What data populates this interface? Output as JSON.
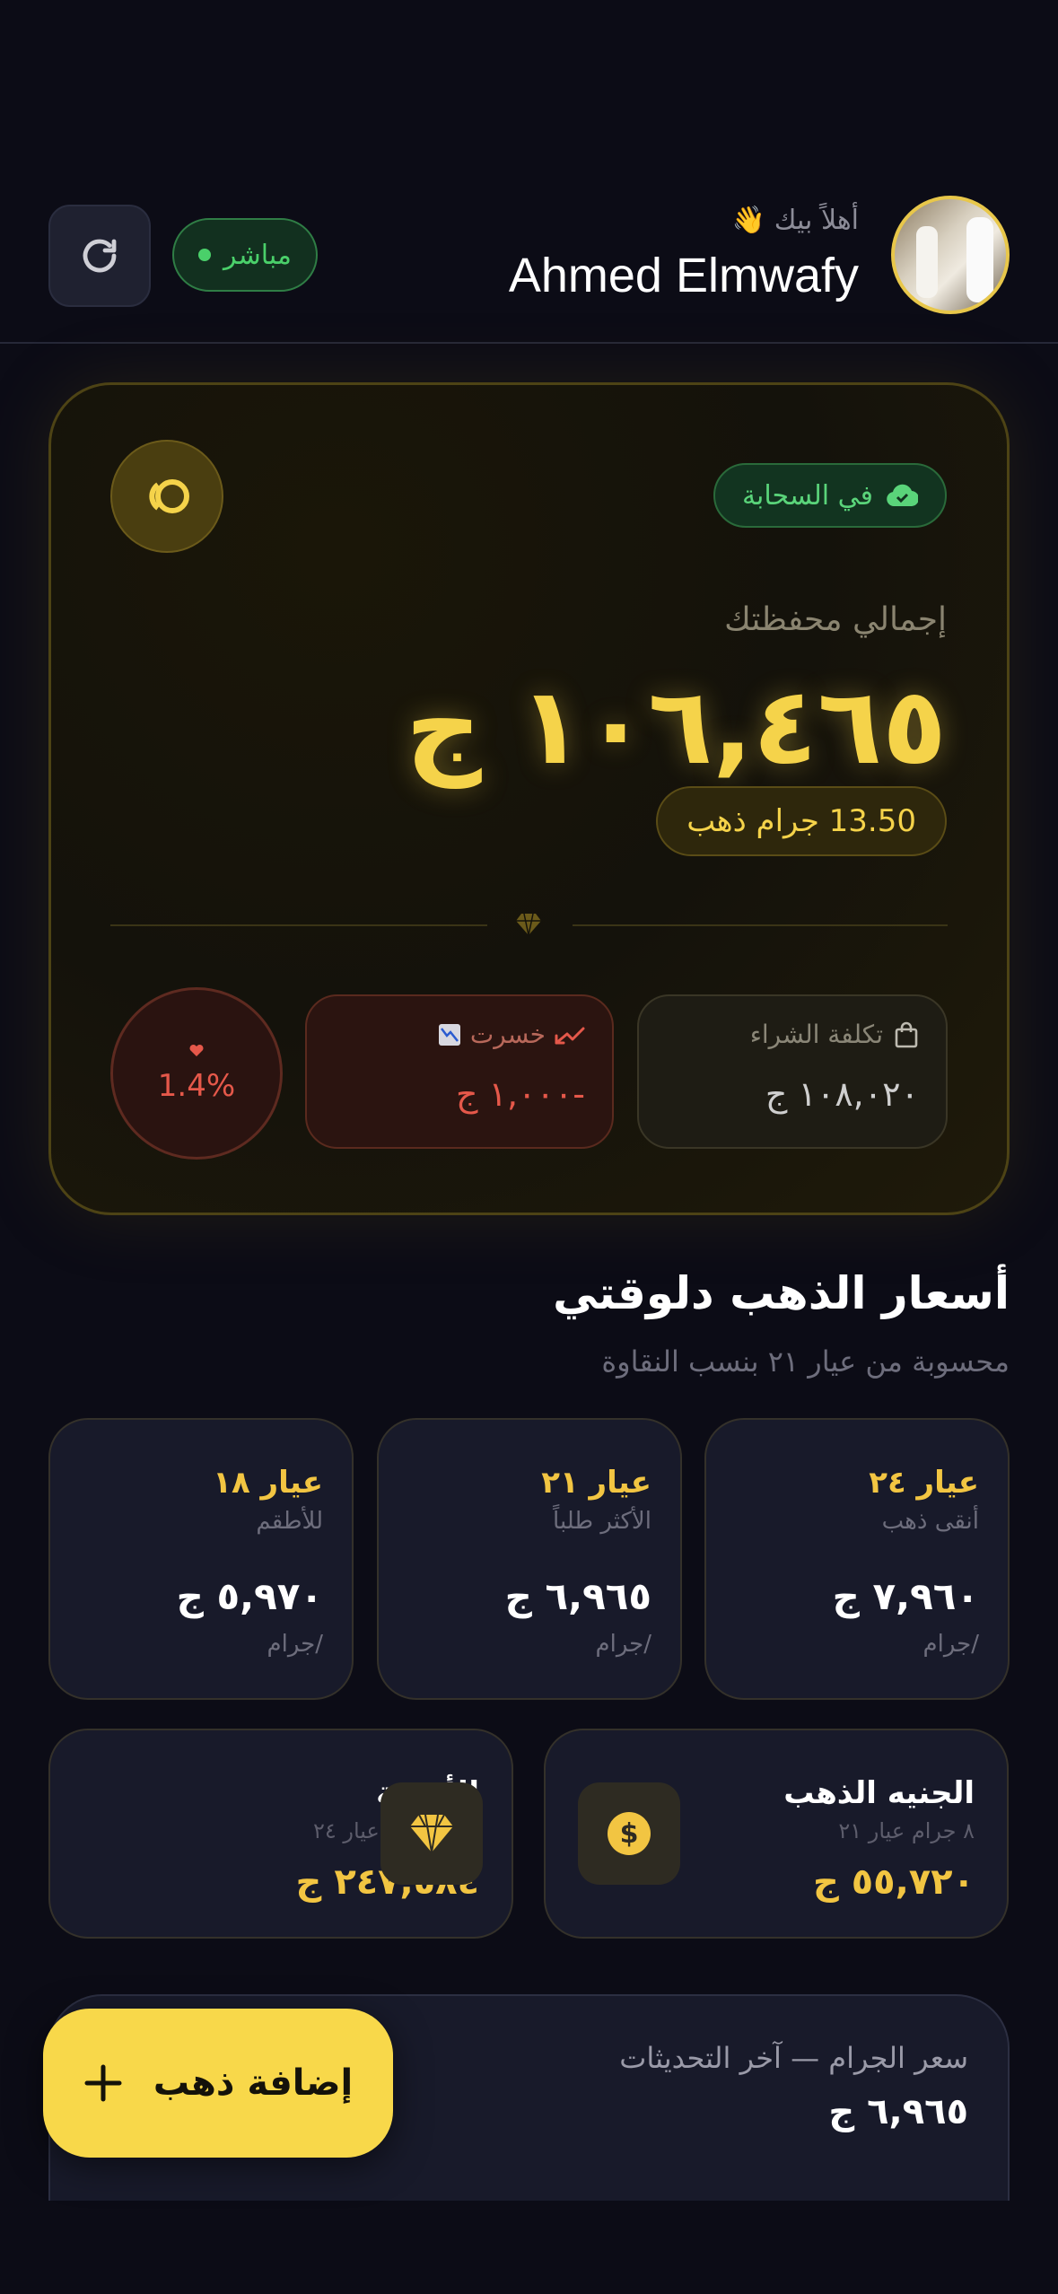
{
  "header": {
    "greeting": "أهلاً بيك 👋",
    "user_name": "Ahmed Elmwafy",
    "live_label": "مباشر"
  },
  "portfolio": {
    "cloud_label": "في السحابة",
    "total_label": "إجمالي محفظتك",
    "total_value": "١٠٦,٤٦٥ ج",
    "grams_label": "13.50 جرام ذهب",
    "cost_label": "تكلفة الشراء",
    "cost_value": "١٠٨,٠٢٠ ج",
    "loss_label": "خسرت",
    "loss_value": "-١,٠٠٠ ج",
    "change_percent": "1.4%"
  },
  "prices": {
    "title": "أسعار الذهب دلوقتي",
    "subtitle": "محسوبة من عيار ٢١ بنسب النقاوة",
    "karats": [
      {
        "karat": "عيار ٢٤",
        "desc": "أنقى ذهب",
        "price": "٧,٩٦٠ ج",
        "unit": "/جرام"
      },
      {
        "karat": "عيار ٢١",
        "desc": "الأكثر طلباً",
        "price": "٦,٩٦٥ ج",
        "unit": "/جرام"
      },
      {
        "karat": "عيار ١٨",
        "desc": "للأطقم",
        "price": "٥,٩٧٠ ج",
        "unit": "/جرام"
      }
    ],
    "pound": {
      "title": "الجنيه الذهب",
      "sub": "٨ جرام عيار ٢١",
      "value": "٥٥,٧٢٠ ج"
    },
    "ounce": {
      "title": "الأوقية",
      "sub": "٣١.١ جرام عيار ٢٤",
      "value": "٢٤٧,٥٨٤ ج"
    }
  },
  "history": {
    "title": "سعر الجرام — آخر التحديثات",
    "value": "٦,٩٦٥ ج"
  },
  "fab": {
    "label": "إضافة ذهب"
  },
  "colors": {
    "gold": "#f5d34a",
    "loss": "#e5584a",
    "live": "#4ad06a",
    "background": "#0c0c16"
  }
}
